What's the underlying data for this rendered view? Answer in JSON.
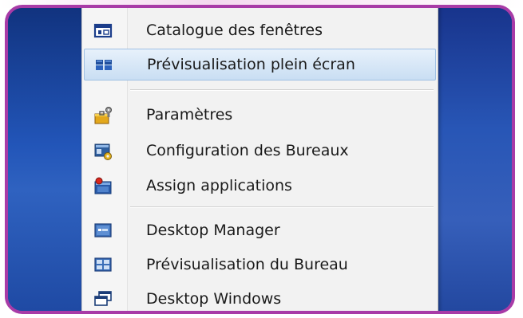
{
  "menu": {
    "items": [
      {
        "label": "Catalogue des fenêtres",
        "icon": "window-catalog-icon",
        "highlighted": false
      },
      {
        "label": "Prévisualisation plein écran",
        "icon": "fullscreen-preview-icon",
        "highlighted": true
      },
      {
        "label": "Paramètres",
        "icon": "settings-toolbox-icon",
        "highlighted": false
      },
      {
        "label": "Configuration des Bureaux",
        "icon": "desktop-config-icon",
        "highlighted": false
      },
      {
        "label": "Assign applications",
        "icon": "assign-apps-icon",
        "highlighted": false
      },
      {
        "label": "Desktop Manager",
        "icon": "desktop-manager-icon",
        "highlighted": false
      },
      {
        "label": "Prévisualisation du Bureau",
        "icon": "desktop-preview-icon",
        "highlighted": false
      },
      {
        "label": "Desktop Windows",
        "icon": "desktop-windows-icon",
        "highlighted": false
      }
    ]
  },
  "colors": {
    "frame_border": "#a83ba7",
    "highlight": "#c9def3",
    "desktop": "#1a4db0"
  }
}
